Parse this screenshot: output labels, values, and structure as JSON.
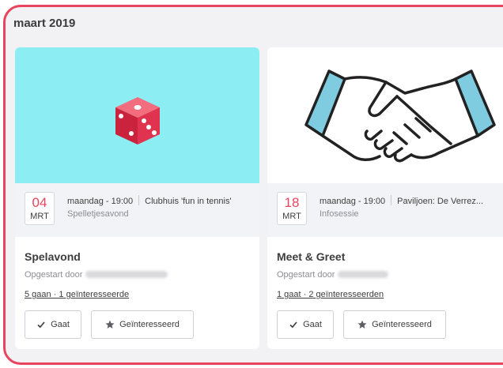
{
  "month_heading": "maart 2019",
  "events": [
    {
      "day": "04",
      "month": "MRT",
      "datetime": "maandag - 19:00",
      "location": "Clubhuis 'fun in tennis'",
      "category": "Spelletjesavond",
      "title": "Spelavond",
      "started_by": "Opgestart door",
      "attendance": "5 gaan · 1 geïnteresseerde",
      "image_icon": "dice-icon",
      "image_bg": "#8ceef3",
      "going_label": "Gaat",
      "interested_label": "Geïnteresseerd"
    },
    {
      "day": "18",
      "month": "MRT",
      "datetime": "maandag - 19:00",
      "location": "Paviljoen: De Verrez...",
      "category": "Infosessie",
      "title": "Meet & Greet",
      "started_by": "Opgestart door",
      "attendance": "1 gaat · 2 geïnteresseerden",
      "image_icon": "handshake-icon",
      "image_bg": "#ffffff",
      "going_label": "Gaat",
      "interested_label": "Geïnteresseerd"
    }
  ],
  "colors": {
    "accent": "#e8445e",
    "frame_bg": "#f2f2f5",
    "text": "#3d3d3d",
    "muted": "#8d8d95"
  }
}
